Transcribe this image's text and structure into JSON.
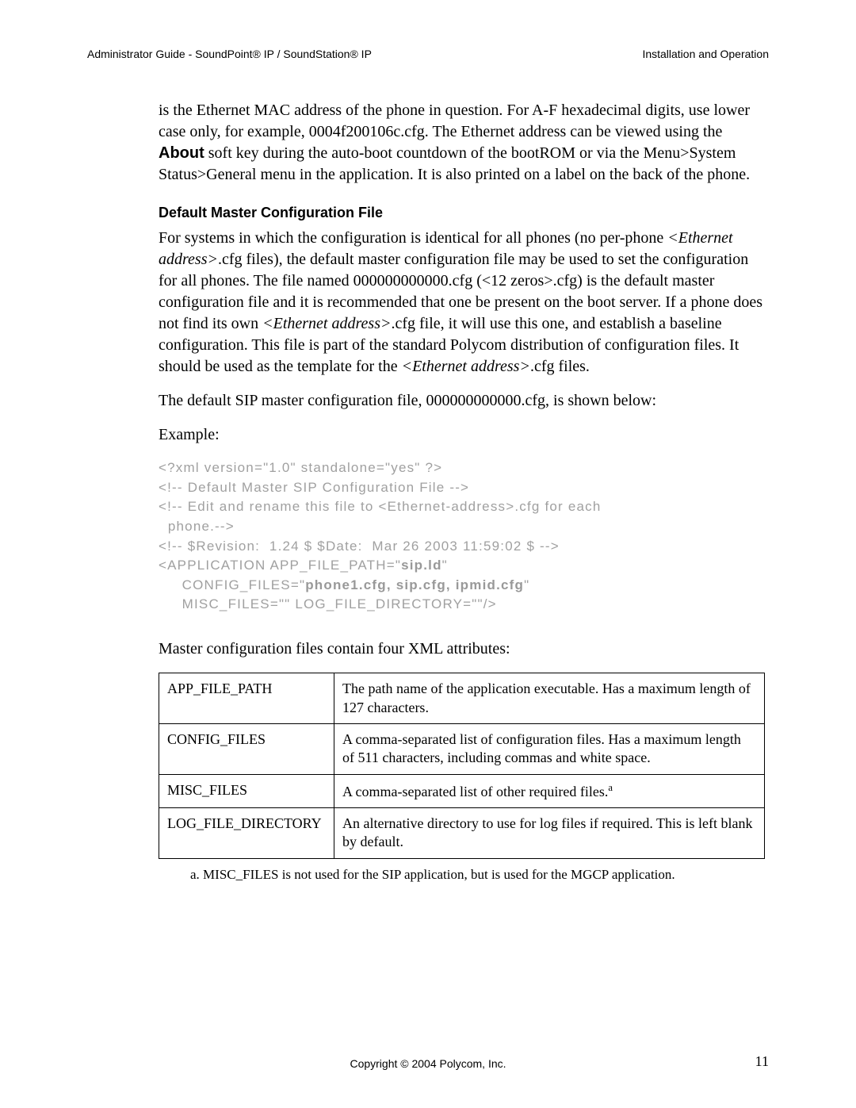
{
  "header": {
    "left": "Administrator Guide - SoundPoint® IP / SoundStation® IP",
    "right": "Installation and Operation"
  },
  "intro": {
    "p1a": "is the Ethernet MAC address of the phone in question.  For A-F hexadecimal digits, use lower case only, for example, 0004f200106c.cfg.  The Ethernet address can be viewed using the ",
    "about": "About",
    "p1b": " soft key during the auto-boot countdown of the bootROM or via the Menu>System Status>General menu in the application.  It is also printed on a label on the back of the phone."
  },
  "section": {
    "title": "Default Master Configuration File",
    "p1a": "For systems in which the configuration is identical for all phones (no per-phone ",
    "eth1": "<Ethernet address>",
    "p1b": ".cfg files), the default master configuration file may be used to set the configuration for all phones.  The file named 000000000000.cfg (<12 zeros>.cfg) is the default master configuration file and it is recommended that one be present on the boot server.  If a phone does not find its own ",
    "eth2": "<Ethernet address>",
    "p1c": ".cfg file, it will use this one, and establish a baseline configuration.  This file is part of the standard Polycom distribution of configuration files.  It should be used as the template for the ",
    "eth3": "<Ethernet address>",
    "p1d": ".cfg files.",
    "p2": "The default SIP master configuration file, 000000000000.cfg, is shown below:",
    "ex": "Example:"
  },
  "code": {
    "l1": "<?xml version=\"1.0\" standalone=\"yes\" ?>",
    "l2": "<!-- Default Master SIP Configuration File -->",
    "l3": "<!-- Edit and rename this file to <Ethernet-address>.cfg for each\n  phone.-->",
    "l4": "<!-- $Revision:  1.24 $ $Date:  Mar 26 2003 11:59:02 $ -->",
    "l5a": "<APPLICATION APP_FILE_PATH=\"",
    "l5b": "sip.ld",
    "l5c": "\"",
    "l6a": "     CONFIG_FILES=\"",
    "l6b": "phone1.cfg, sip.cfg, ipmid.cfg",
    "l6c": "\"",
    "l7": "     MISC_FILES=\"\" LOG_FILE_DIRECTORY=\"\"/>"
  },
  "table_intro": "Master configuration files contain four XML attributes:",
  "table": {
    "rows": [
      {
        "name": "APP_FILE_PATH",
        "desc": "The path name of the application executable.  Has a maximum length of 127 characters."
      },
      {
        "name": "CONFIG_FILES",
        "desc": "A comma-separated list of configuration files.  Has a maximum length of 511 characters, including commas and white space."
      },
      {
        "name": "MISC_FILES",
        "desc_a": "A comma-separated list of other required files.",
        "sup": "a"
      },
      {
        "name": "LOG_FILE_DIRECTORY",
        "desc": "An alternative directory to use for log files if required.  This is left blank by default."
      }
    ]
  },
  "footnote": "a. MISC_FILES is not used for the SIP application, but is used for the MGCP application.",
  "footer": {
    "copyright": "Copyright © 2004 Polycom, Inc.",
    "page": "11"
  }
}
